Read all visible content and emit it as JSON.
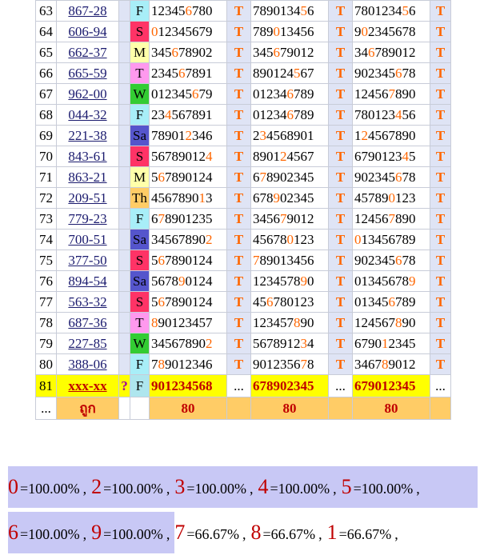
{
  "rows": [
    {
      "no": "63",
      "code": "867-28",
      "day": "F",
      "day_color": "#a8eef8",
      "s1": [
        "12345",
        "6",
        "780"
      ],
      "s2": [
        "7890134",
        "5",
        "6"
      ],
      "s3": [
        "7801234",
        "5",
        "6"
      ],
      "t": [
        "T",
        "T",
        "T"
      ]
    },
    {
      "no": "64",
      "code": "606-94",
      "day": "S",
      "day_color": "#ff3366",
      "s1": [
        "",
        "0",
        "12345679"
      ],
      "s2": [
        "789",
        "0",
        "13456"
      ],
      "s3": [
        "9",
        "0",
        "2345678"
      ],
      "t": [
        "T",
        "T",
        "T"
      ]
    },
    {
      "no": "65",
      "code": "662-37",
      "day": "M",
      "day_color": "#ffffaa",
      "s1": [
        "345",
        "6",
        "78902"
      ],
      "s2": [
        "345",
        "6",
        "79012"
      ],
      "s3": [
        "34",
        "6",
        "789012"
      ],
      "t": [
        "T",
        "T",
        "T"
      ]
    },
    {
      "no": "66",
      "code": "665-59",
      "day": "T",
      "day_color": "#ff99ee",
      "s1": [
        "2345",
        "6",
        "7891"
      ],
      "s2": [
        "890124",
        "5",
        "67"
      ],
      "s3": [
        "902345",
        "6",
        "78"
      ],
      "t": [
        "T",
        "T",
        "T"
      ]
    },
    {
      "no": "67",
      "code": "962-00",
      "day": "W",
      "day_color": "#33cc33",
      "s1": [
        "012345",
        "6",
        "79"
      ],
      "s2": [
        "01234",
        "6",
        "789"
      ],
      "s3": [
        "12456",
        "7",
        "890"
      ],
      "t": [
        "T",
        "T",
        "T"
      ]
    },
    {
      "no": "68",
      "code": "044-32",
      "day": "F",
      "day_color": "#a8eef8",
      "s1": [
        "23",
        "4",
        "567891"
      ],
      "s2": [
        "01234",
        "6",
        "789"
      ],
      "s3": [
        "780123",
        "4",
        "56"
      ],
      "t": [
        "T",
        "T",
        "T"
      ]
    },
    {
      "no": "69",
      "code": "221-38",
      "day": "Sa",
      "day_color": "#5555cc",
      "s1": [
        "78901",
        "2",
        "346"
      ],
      "s2": [
        "2",
        "3",
        "4568901"
      ],
      "s3": [
        "1",
        "2",
        "4567890"
      ],
      "t": [
        "T",
        "T",
        "T"
      ]
    },
    {
      "no": "70",
      "code": "843-61",
      "day": "S",
      "day_color": "#ff3366",
      "s1": [
        "56789012",
        "4",
        ""
      ],
      "s2": [
        "8901",
        "2",
        "4567"
      ],
      "s3": [
        "6790123",
        "4",
        "5"
      ],
      "t": [
        "T",
        "T",
        "T"
      ]
    },
    {
      "no": "71",
      "code": "863-21",
      "day": "M",
      "day_color": "#ffffaa",
      "s1": [
        "5",
        "6",
        "7890124"
      ],
      "s2": [
        "6",
        "7",
        "8902345"
      ],
      "s3": [
        "902345",
        "6",
        "78"
      ],
      "t": [
        "T",
        "T",
        "T"
      ]
    },
    {
      "no": "72",
      "code": "209-51",
      "day": "Th",
      "day_color": "#ffcc66",
      "s1": [
        "4567890",
        "1",
        "3"
      ],
      "s2": [
        "678",
        "9",
        "02345"
      ],
      "s3": [
        "45789",
        "0",
        "123"
      ],
      "t": [
        "T",
        "T",
        "T"
      ]
    },
    {
      "no": "73",
      "code": "779-23",
      "day": "F",
      "day_color": "#a8eef8",
      "s1": [
        "6",
        "7",
        "8901235"
      ],
      "s2": [
        "3456",
        "7",
        "9012"
      ],
      "s3": [
        "12456",
        "7",
        "890"
      ],
      "t": [
        "T",
        "T",
        "T"
      ]
    },
    {
      "no": "74",
      "code": "700-51",
      "day": "Sa",
      "day_color": "#5555cc",
      "s1": [
        "34567890",
        "2",
        ""
      ],
      "s2": [
        "45678",
        "0",
        "123"
      ],
      "s3": [
        "",
        "0",
        "13456789"
      ],
      "t": [
        "T",
        "T",
        "T"
      ]
    },
    {
      "no": "75",
      "code": "377-50",
      "day": "S",
      "day_color": "#ff3366",
      "s1": [
        "5",
        "6",
        "7890124"
      ],
      "s2": [
        "",
        "7",
        "89013456"
      ],
      "s3": [
        "902345",
        "6",
        "78"
      ],
      "t": [
        "T",
        "T",
        "T"
      ]
    },
    {
      "no": "76",
      "code": "894-54",
      "day": "Sa",
      "day_color": "#5555cc",
      "s1": [
        "5678",
        "9",
        "0124"
      ],
      "s2": [
        "1234578",
        "9",
        "0"
      ],
      "s3": [
        "01345678",
        "9",
        ""
      ],
      "t": [
        "T",
        "T",
        "T"
      ]
    },
    {
      "no": "77",
      "code": "563-32",
      "day": "S",
      "day_color": "#ff3366",
      "s1": [
        "5",
        "6",
        "7890124"
      ],
      "s2": [
        "45",
        "6",
        "780123"
      ],
      "s3": [
        "01345",
        "6",
        "789"
      ],
      "t": [
        "T",
        "T",
        "T"
      ]
    },
    {
      "no": "78",
      "code": "687-36",
      "day": "T",
      "day_color": "#ff99ee",
      "s1": [
        "",
        "8",
        "90123457"
      ],
      "s2": [
        "123457",
        "8",
        "90"
      ],
      "s3": [
        "124567",
        "8",
        "90"
      ],
      "t": [
        "T",
        "T",
        "T"
      ]
    },
    {
      "no": "79",
      "code": "227-85",
      "day": "W",
      "day_color": "#33cc33",
      "s1": [
        "34567890",
        "2",
        ""
      ],
      "s2": [
        "5678912",
        "3",
        "4"
      ],
      "s3": [
        "6790",
        "1",
        "2345"
      ],
      "t": [
        "T",
        "T",
        "T"
      ]
    },
    {
      "no": "80",
      "code": "388-06",
      "day": "F",
      "day_color": "#a8eef8",
      "s1": [
        "7",
        "8",
        "9012346"
      ],
      "s2": [
        "9012356",
        "7",
        "8"
      ],
      "s3": [
        "3467",
        "8",
        "9012"
      ],
      "t": [
        "T",
        "T",
        "T"
      ]
    }
  ],
  "pending": {
    "no": "81",
    "code": "xxx-xx",
    "mark": "?",
    "day": "F",
    "s1": "901234568",
    "s2": "678902345",
    "s3": "679012345",
    "e": [
      "...",
      "...",
      "..."
    ]
  },
  "totals": {
    "lead": "...",
    "label": "ถูก",
    "v1": "80",
    "v2": "80",
    "v3": "80"
  },
  "stats": [
    {
      "digit": "0",
      "pct": "=100.00%",
      "sep": ","
    },
    {
      "digit": "2",
      "pct": "=100.00%",
      "sep": ","
    },
    {
      "digit": "3",
      "pct": "=100.00%",
      "sep": ","
    },
    {
      "digit": "4",
      "pct": "=100.00%",
      "sep": ","
    },
    {
      "digit": "5",
      "pct": "=100.00%",
      "sep": ","
    },
    {
      "digit": "6",
      "pct": "=100.00%",
      "sep": ","
    },
    {
      "digit": "9",
      "pct": "=100.00%",
      "sep": ","
    },
    {
      "digit": "7",
      "pct": "=66.67%",
      "sep": ","
    },
    {
      "digit": "8",
      "pct": "=66.67%",
      "sep": ","
    },
    {
      "digit": "1",
      "pct": "=66.67%",
      "sep": ","
    }
  ]
}
